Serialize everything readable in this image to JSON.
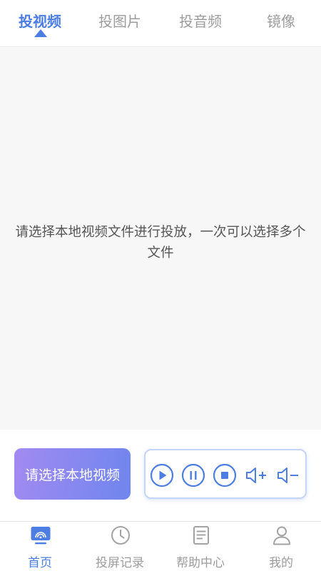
{
  "top_tabs": [
    {
      "label": "投视频",
      "active": true
    },
    {
      "label": "投图片",
      "active": false
    },
    {
      "label": "投音频",
      "active": false
    },
    {
      "label": "镜像",
      "active": false
    }
  ],
  "main": {
    "empty_line1": "请选择本地视频文件进行投放，一次可以选择多个",
    "empty_line2": "文件"
  },
  "controls": {
    "select_label": "请选择本地视频",
    "buttons": [
      "play-icon",
      "pause-icon",
      "stop-icon",
      "volume-up-icon",
      "volume-down-icon"
    ]
  },
  "bottom_nav": [
    {
      "label": "首页",
      "icon": "cast-screen-icon",
      "active": true
    },
    {
      "label": "投屏记录",
      "icon": "clock-icon",
      "active": false
    },
    {
      "label": "帮助中心",
      "icon": "document-icon",
      "active": false
    },
    {
      "label": "我的",
      "icon": "user-icon",
      "active": false
    }
  ],
  "colors": {
    "accent": "#4b7de3",
    "inactive": "#9c9c9c",
    "button_gradient_start": "#a28af1",
    "button_gradient_end": "#6f86ee"
  }
}
